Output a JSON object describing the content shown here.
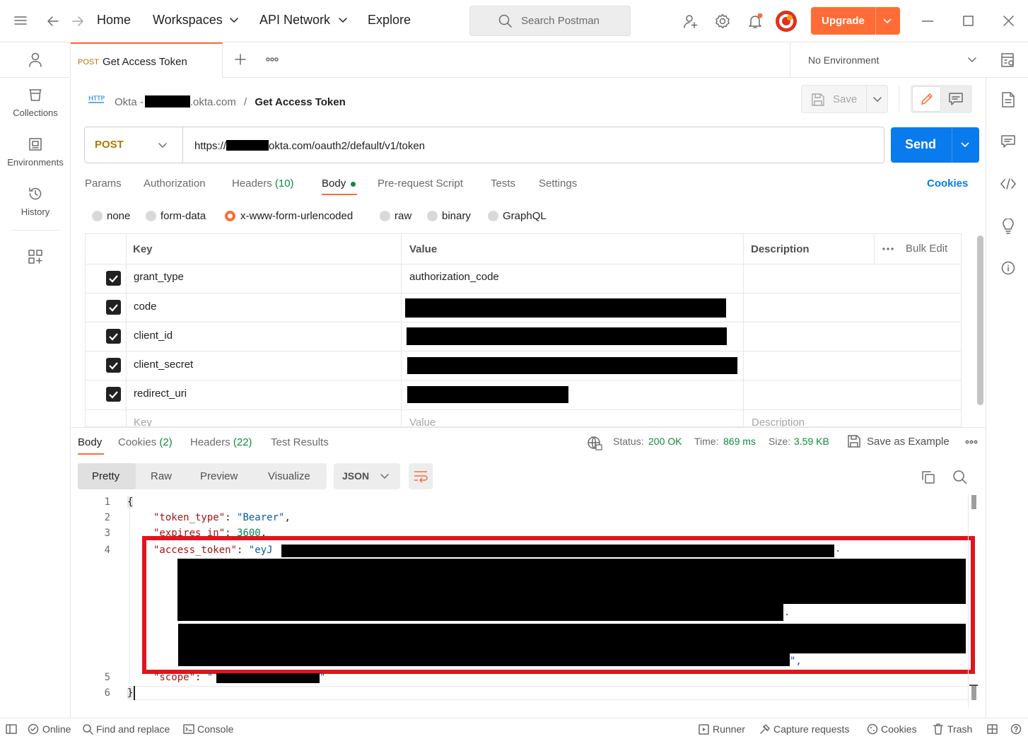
{
  "topbar": {
    "nav": [
      "Home",
      "Workspaces",
      "API Network",
      "Explore"
    ],
    "search_placeholder": "Search Postman",
    "upgrade_label": "Upgrade"
  },
  "sidebar": {
    "items": [
      {
        "label": "Collections",
        "icon": "collections-icon"
      },
      {
        "label": "Environments",
        "icon": "environments-icon"
      },
      {
        "label": "History",
        "icon": "history-icon"
      }
    ]
  },
  "tabs": {
    "active": {
      "method": "POST",
      "title": "Get Access Token"
    },
    "environment": "No Environment"
  },
  "request": {
    "breadcrumb_prefix": "Okta -",
    "breadcrumb_suffix": ".okta.com",
    "breadcrumb_sep": "/",
    "name": "Get Access Token",
    "save_label": "Save",
    "method": "POST",
    "url_prefix": "https://",
    "url_suffix": "okta.com/oauth2/default/v1/token",
    "send_label": "Send",
    "tabs": {
      "params": "Params",
      "authorization": "Authorization",
      "headers": "Headers",
      "headers_count": "(10)",
      "body": "Body",
      "prerequest": "Pre-request Script",
      "tests": "Tests",
      "settings": "Settings",
      "cookies": "Cookies"
    },
    "body_types": [
      "none",
      "form-data",
      "x-www-form-urlencoded",
      "raw",
      "binary",
      "GraphQL"
    ],
    "selected_body_type": "x-www-form-urlencoded",
    "table": {
      "headers": {
        "key": "Key",
        "value": "Value",
        "description": "Description",
        "bulk_edit": "Bulk Edit"
      },
      "rows": [
        {
          "key": "grant_type",
          "value": "authorization_code",
          "checked": true
        },
        {
          "key": "code",
          "value": "",
          "checked": true
        },
        {
          "key": "client_id",
          "value": "",
          "checked": true
        },
        {
          "key": "client_secret",
          "value": "",
          "checked": true
        },
        {
          "key": "redirect_uri",
          "value": "",
          "checked": true
        }
      ],
      "placeholders": {
        "key": "Key",
        "value": "Value",
        "description": "Description"
      }
    }
  },
  "response": {
    "tabs": {
      "body": "Body",
      "cookies": "Cookies",
      "cookies_count": "(2)",
      "headers": "Headers",
      "headers_count": "(22)",
      "test_results": "Test Results"
    },
    "status_label": "Status:",
    "status_value": "200 OK",
    "time_label": "Time:",
    "time_value": "869 ms",
    "size_label": "Size:",
    "size_value": "3.59 KB",
    "save_example": "Save as Example",
    "view_modes": [
      "Pretty",
      "Raw",
      "Preview",
      "Visualize"
    ],
    "format": "JSON",
    "code": {
      "line_numbers": [
        "1",
        "2",
        "3",
        "4",
        "5",
        "6"
      ],
      "open_brace": "{",
      "close_brace": "}",
      "token_type_key": "\"token_type\"",
      "token_type_value": "\"Bearer\"",
      "expires_key": "\"expires_in\"",
      "expires_value": "3600",
      "access_token_key": "\"access_token\"",
      "access_token_prefix": "\"eyJ",
      "scope_key": "\"scope\"",
      "scope_open": "\"",
      "scope_close": "\""
    }
  },
  "statusbar": {
    "online": "Online",
    "find_replace": "Find and replace",
    "console": "Console",
    "runner": "Runner",
    "capture": "Capture requests",
    "cookies": "Cookies",
    "trash": "Trash"
  },
  "colors": {
    "accent": "#ff6c37",
    "send_blue": "#097bed",
    "status_green": "#0f8a3c",
    "highlight_red": "#e0141e"
  }
}
